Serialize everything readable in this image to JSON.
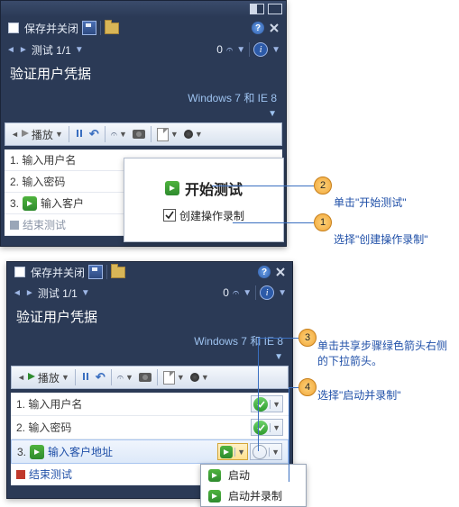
{
  "header": {
    "save_close": "保存并关闭"
  },
  "testbar": {
    "counter": "测试 1/1",
    "zero": "0"
  },
  "title": "验证用户凭据",
  "config": "Windows 7 和 IE 8",
  "toolbar": {
    "play": "播放"
  },
  "steps_top": {
    "s1": "1. 输入用户名",
    "s2": "2. 输入密码",
    "s3": "3.",
    "s3_rest": "输入客户",
    "end": "结束测试"
  },
  "popup_start": {
    "label": "开始测试",
    "chk": "创建操作录制"
  },
  "steps_bot": {
    "s1": "1. 输入用户名",
    "s2": "2. 输入密码",
    "s3": "3.",
    "s3_rest": "输入客户地址",
    "end": "结束测试"
  },
  "menu": {
    "m1": "启动",
    "m2": "启动并录制"
  },
  "call": {
    "c1_num": "1",
    "c1_txt": "选择\"创建操作录制\"",
    "c2_num": "2",
    "c2_txt": "单击\"开始测试\"",
    "c3_num": "3",
    "c3_txt": "单击共享步骤绿色箭头右侧的下拉箭头。",
    "c4_num": "4",
    "c4_txt": "选择\"启动并录制\""
  }
}
